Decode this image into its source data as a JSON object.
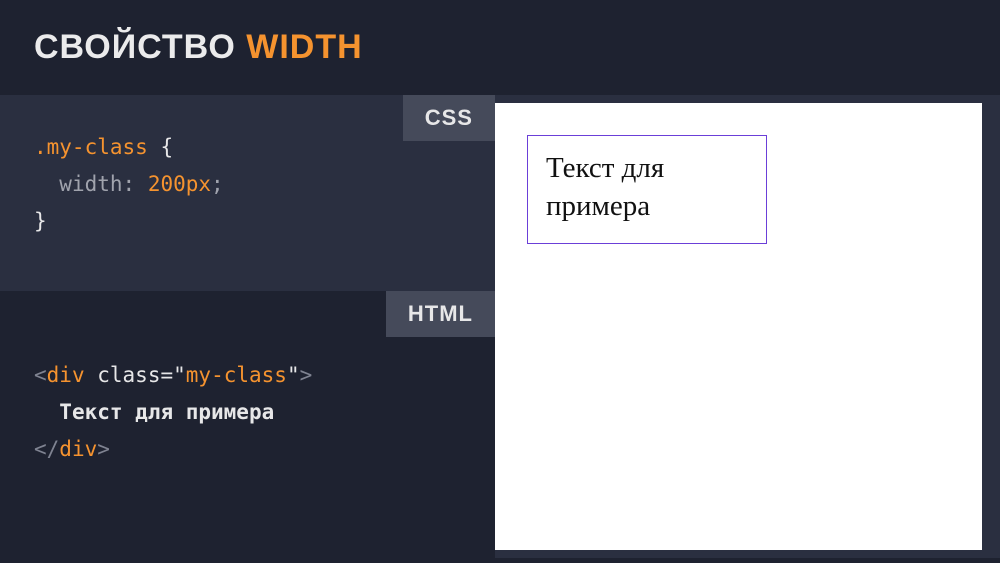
{
  "header": {
    "label": "СВОЙСТВО",
    "property": "WIDTH"
  },
  "labels": {
    "css": "CSS",
    "html": "HTML"
  },
  "css": {
    "selector": ".my-class",
    "brace_open": "{",
    "prop": "width",
    "colon": ":",
    "value": "200px",
    "semicolon": ";",
    "brace_close": "}"
  },
  "html_code": {
    "open_angle": "<",
    "tag": "div",
    "attr_name": "class",
    "eq": "=",
    "quote": "\"",
    "attr_value": "my-class",
    "close_angle": ">",
    "text": "Текст для примера",
    "open_angle_close": "</",
    "close_angle2": ">"
  },
  "preview": {
    "text": "Текст для примера"
  }
}
